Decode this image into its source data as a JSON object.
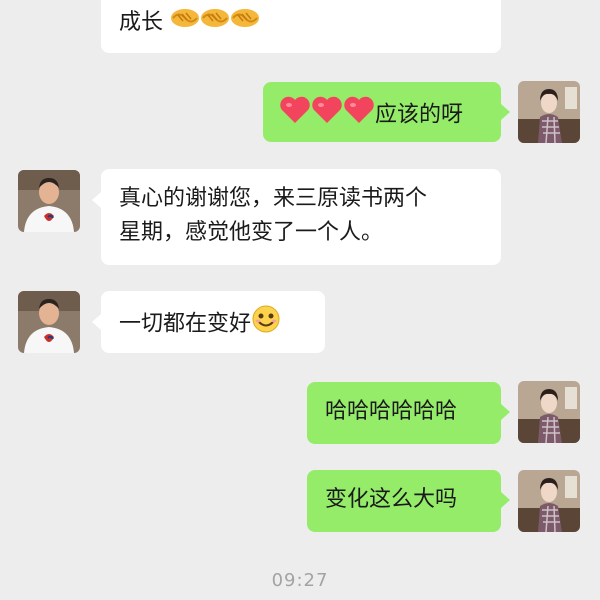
{
  "colors": {
    "background": "#ededed",
    "incoming_bubble": "#ffffff",
    "outgoing_bubble": "#95ec69",
    "timestamp": "#a3a3a3"
  },
  "messages": [
    {
      "from": "contact",
      "text": "成长",
      "emoji": [
        "handshake-emoji",
        "handshake-emoji",
        "handshake-emoji"
      ]
    },
    {
      "from": "me",
      "emoji": [
        "heart-emoji",
        "heart-emoji",
        "heart-emoji"
      ],
      "text": "应该的呀"
    },
    {
      "from": "contact",
      "line1": "真心的谢谢您，来三原读书两个",
      "line2": "星期，感觉他变了一个人。"
    },
    {
      "from": "contact",
      "text": "一切都在变好",
      "emoji": [
        "smile-emoji"
      ]
    },
    {
      "from": "me",
      "text": "哈哈哈哈哈哈"
    },
    {
      "from": "me",
      "text": "变化这么大吗"
    }
  ],
  "timestamp": "09:27"
}
